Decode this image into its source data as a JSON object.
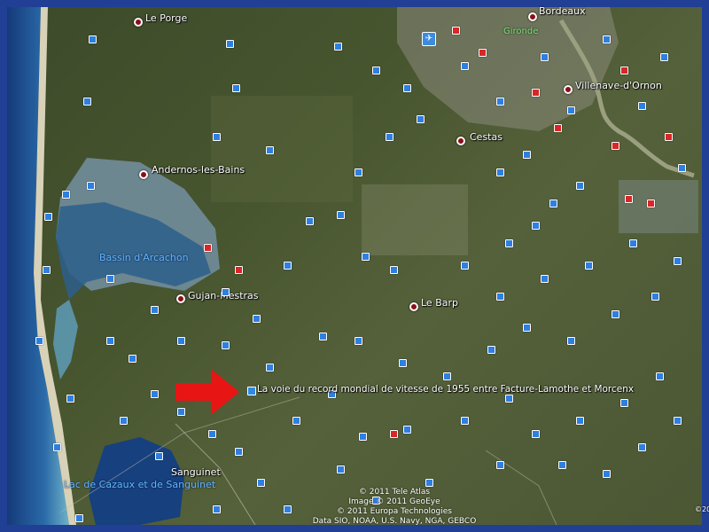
{
  "places": {
    "le_porge": "Le Porge",
    "bordeaux": "Bordeaux",
    "gironde": "Gironde",
    "villenave": "Villenave-d'Ornon",
    "cestas": "Cestas",
    "andernos": "Andernos-les-Bains",
    "bassin": "Bassin d'Arcachon",
    "gujan": "Gujan-Mestras",
    "le_barp": "Le Barp",
    "sanguinet": "Sanguinet",
    "lac": "Lac de Cazaux et de Sanguinet"
  },
  "marker": {
    "label": "La voie du record mondial de vitesse de 1955 entre Facture-Lamothe et Morcenx",
    "icon": "photo-marker-icon"
  },
  "arrow_color": "#e81515",
  "credits": {
    "line1": "© 2011 Tele Atlas",
    "line2": "Image © 2011 GeoEye",
    "line3": "© 2011 Europa Technologies",
    "line4": "Data SIO, NOAA, U.S. Navy, NGA, GEBCO"
  },
  "edge_text": "©20"
}
